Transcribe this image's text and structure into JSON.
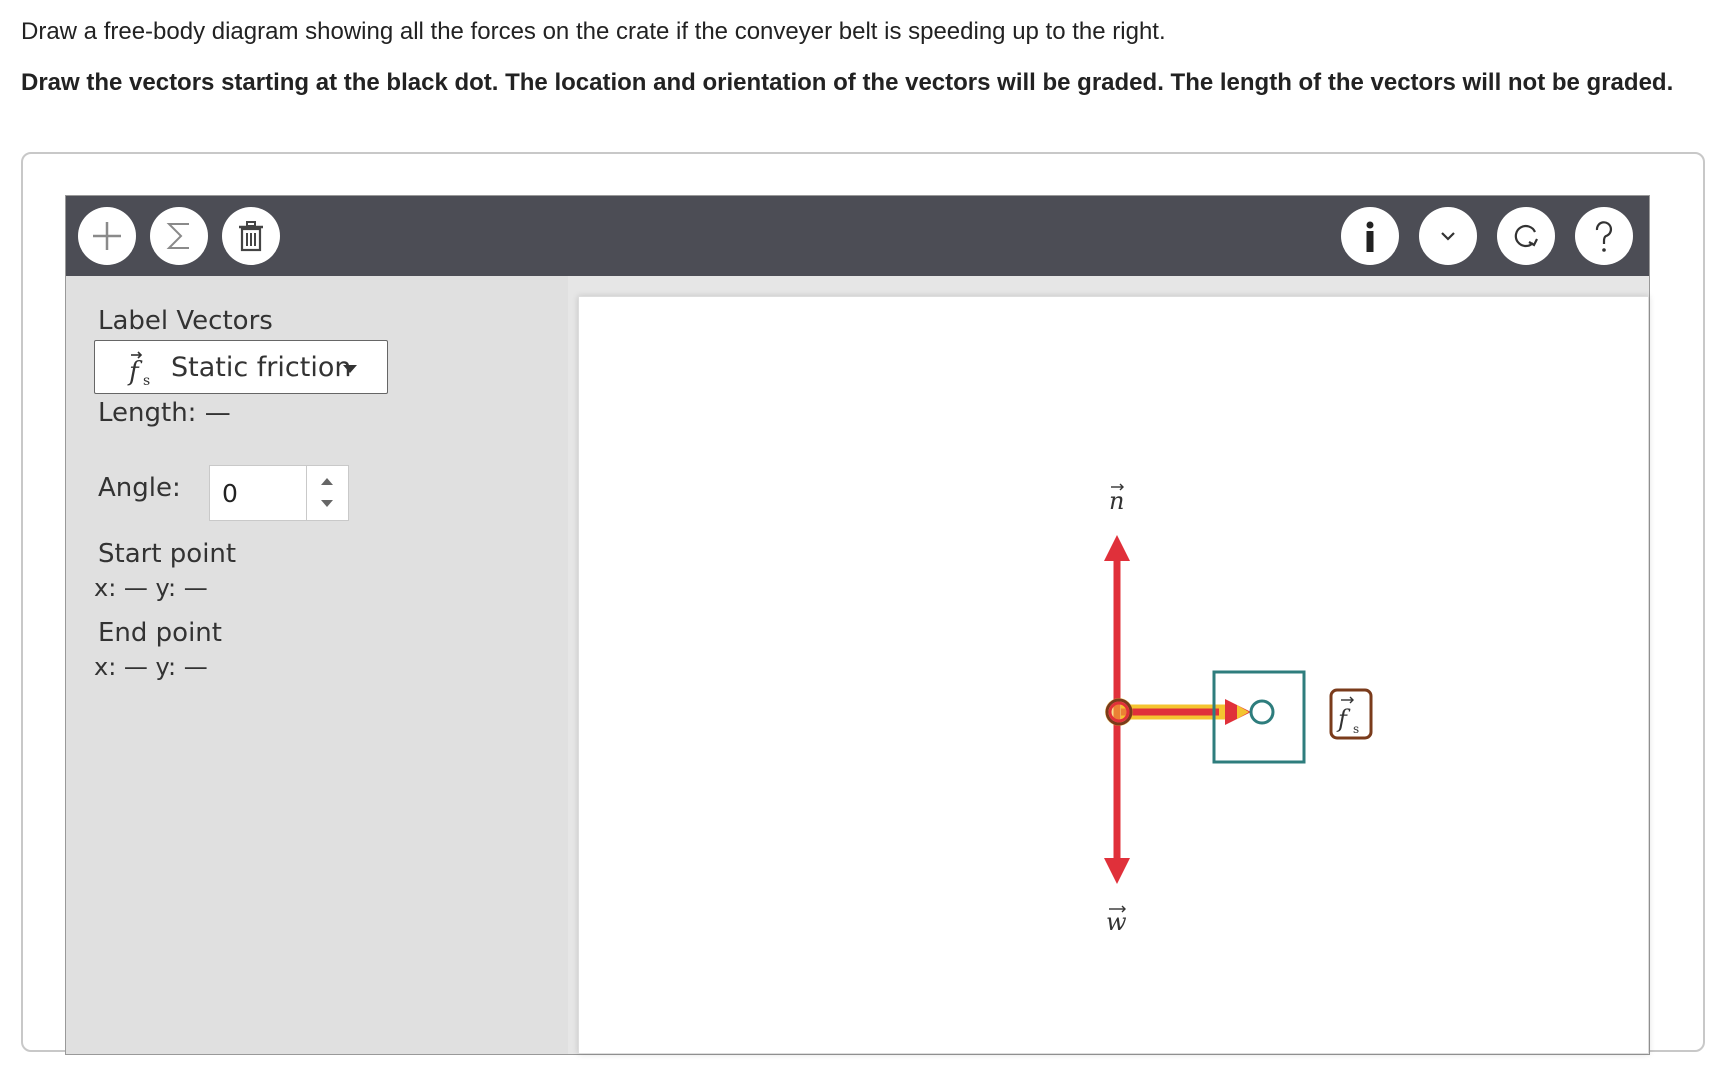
{
  "question": {
    "prompt": "Draw a free-body diagram showing all the forces on the crate if the conveyer belt is speeding up to the right.",
    "instructions": "Draw the vectors starting at the black dot. The location and orientation of the vectors will be graded. The length of the vectors will not be graded."
  },
  "toolbar": {
    "left_buttons": [
      {
        "name": "add-vector-button",
        "icon": "plus-icon"
      },
      {
        "name": "sum-vectors-button",
        "icon": "sigma-icon"
      },
      {
        "name": "delete-button",
        "icon": "trash-icon"
      }
    ],
    "right_buttons": [
      {
        "name": "info-button",
        "icon": "info-icon"
      },
      {
        "name": "expand-button",
        "icon": "chevron-down-icon"
      },
      {
        "name": "reset-button",
        "icon": "reset-icon"
      },
      {
        "name": "help-button",
        "icon": "question-icon"
      }
    ]
  },
  "sidebar": {
    "label_vectors": "Label Vectors",
    "selected_vector": {
      "symbol": "f",
      "subscript": "s",
      "label": "Static friction"
    },
    "length_label": "Length:",
    "length_value": "—",
    "angle_label": "Angle:",
    "angle_value": "0",
    "start_point_label": "Start point",
    "start_point_value": "x: — y: —",
    "end_point_label": "End point",
    "end_point_value": "x: — y: —"
  },
  "canvas": {
    "vectors": [
      {
        "label": "n",
        "direction": "up",
        "color": "#e0303a"
      },
      {
        "label": "w",
        "direction": "down",
        "color": "#e0303a"
      },
      {
        "label": "f",
        "subscript": "s",
        "direction": "right",
        "color": "#e0303a",
        "highlight": "#f4c430",
        "selected": true
      }
    ],
    "label_tag": {
      "symbol": "f",
      "subscript": "s",
      "border_color": "#7a3b1b"
    },
    "selection_box_color": "#2e7d7d"
  }
}
